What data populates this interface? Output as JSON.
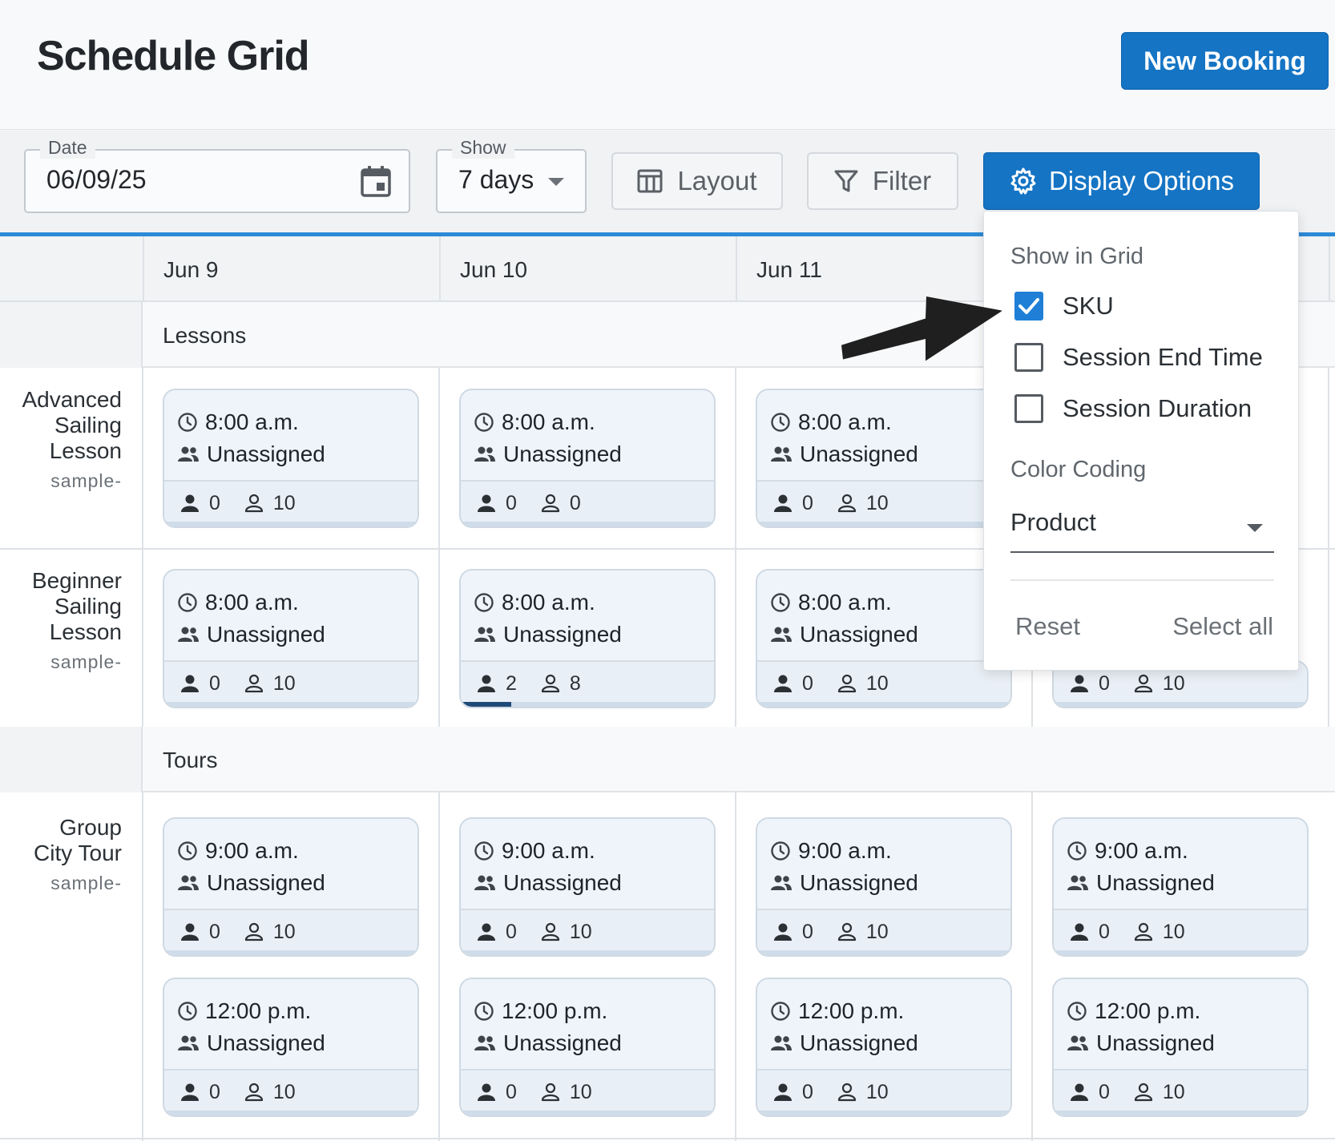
{
  "header": {
    "title": "Schedule Grid",
    "new_booking": "New Booking"
  },
  "toolbar": {
    "date_label": "Date",
    "date_value": "06/09/25",
    "show_label": "Show",
    "show_value": "7 days",
    "layout": "Layout",
    "filter": "Filter",
    "display_options": "Display Options"
  },
  "grid": {
    "dates": [
      "Jun 9",
      "Jun 10",
      "Jun 11"
    ],
    "sections": [
      {
        "label": "Lessons"
      },
      {
        "label": "Tours"
      }
    ],
    "products": [
      {
        "name": [
          "Advanced",
          "Sailing",
          "Lesson"
        ],
        "sku": "sample-"
      },
      {
        "name": [
          "Beginner",
          "Sailing",
          "Lesson"
        ],
        "sku": "sample-"
      },
      {
        "name": [
          "Group",
          "City Tour"
        ],
        "sku": "sample-"
      }
    ],
    "sessions": {
      "r0": [
        {
          "time": "8:00 a.m.",
          "guide": "Unassigned",
          "booked": "0",
          "available": "10",
          "fill": 0
        },
        {
          "time": "8:00 a.m.",
          "guide": "Unassigned",
          "booked": "0",
          "available": "0",
          "fill": 0
        },
        {
          "time": "8:00 a.m.",
          "guide": "Unassigned",
          "booked": "0",
          "available": "10",
          "fill": 0
        }
      ],
      "r1": [
        {
          "time": "8:00 a.m.",
          "guide": "Unassigned",
          "booked": "0",
          "available": "10",
          "fill": 0
        },
        {
          "time": "8:00 a.m.",
          "guide": "Unassigned",
          "booked": "2",
          "available": "8",
          "fill": 0.2
        },
        {
          "time": "8:00 a.m.",
          "guide": "Unassigned",
          "booked": "0",
          "available": "10",
          "fill": 0
        },
        {
          "booked": "0",
          "available": "10",
          "fill": 0
        }
      ],
      "r2a": [
        {
          "time": "9:00 a.m.",
          "guide": "Unassigned",
          "booked": "0",
          "available": "10",
          "fill": 0
        },
        {
          "time": "9:00 a.m.",
          "guide": "Unassigned",
          "booked": "0",
          "available": "10",
          "fill": 0
        },
        {
          "time": "9:00 a.m.",
          "guide": "Unassigned",
          "booked": "0",
          "available": "10",
          "fill": 0
        },
        {
          "time": "9:00 a.m.",
          "guide": "Unassigned",
          "booked": "0",
          "available": "10",
          "fill": 0
        }
      ],
      "r2b": [
        {
          "time": "12:00 p.m.",
          "guide": "Unassigned",
          "booked": "0",
          "available": "10",
          "fill": 0
        },
        {
          "time": "12:00 p.m.",
          "guide": "Unassigned",
          "booked": "0",
          "available": "10",
          "fill": 0
        },
        {
          "time": "12:00 p.m.",
          "guide": "Unassigned",
          "booked": "0",
          "available": "10",
          "fill": 0
        },
        {
          "time": "12:00 p.m.",
          "guide": "Unassigned",
          "booked": "0",
          "available": "10",
          "fill": 0
        }
      ]
    }
  },
  "display_options": {
    "show_in_grid": "Show in Grid",
    "options": [
      {
        "label": "SKU",
        "checked": true
      },
      {
        "label": "Session End Time",
        "checked": false
      },
      {
        "label": "Session Duration",
        "checked": false
      }
    ],
    "color_coding": "Color Coding",
    "color_coding_value": "Product",
    "reset": "Reset",
    "select_all": "Select all"
  },
  "colors": {
    "primary": "#1574c4",
    "accent_line": "#2c8ad6",
    "card_bg": "#edf3f9",
    "checked": "#1f7fd6"
  }
}
